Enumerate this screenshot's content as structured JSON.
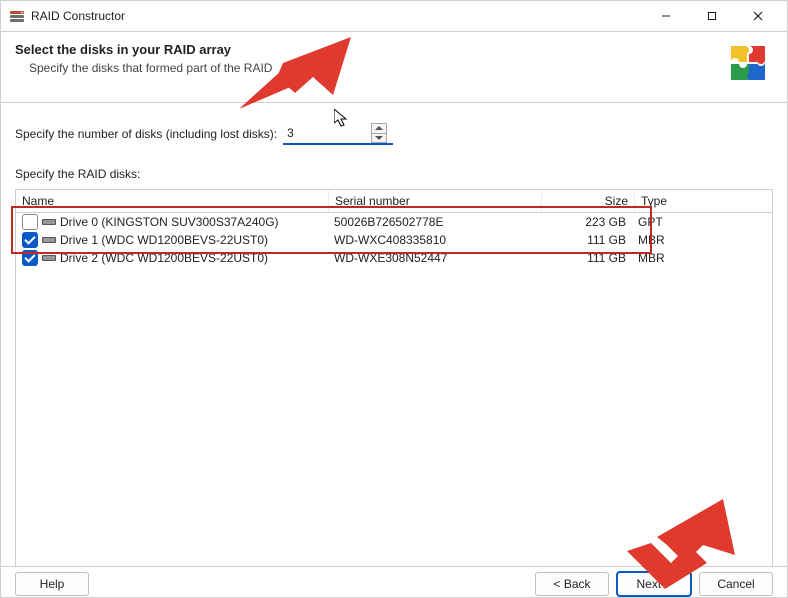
{
  "window": {
    "title": "RAID Constructor"
  },
  "banner": {
    "title": "Select the disks in your RAID array",
    "subtitle": "Specify the disks that formed part of the RAID"
  },
  "numdisks": {
    "label": "Specify the number of disks (including lost disks):",
    "value": "3"
  },
  "raiddisks": {
    "label": "Specify the RAID disks:",
    "columns": {
      "name": "Name",
      "serial": "Serial number",
      "size": "Size",
      "type": "Type"
    },
    "rows": [
      {
        "checked": false,
        "name": "Drive 0 (KINGSTON SUV300S37A240G)",
        "serial": "50026B726502778E",
        "size": "223 GB",
        "type": "GPT"
      },
      {
        "checked": true,
        "name": "Drive 1 (WDC WD1200BEVS-22UST0)",
        "serial": "WD-WXC408335810",
        "size": "111 GB",
        "type": "MBR"
      },
      {
        "checked": true,
        "name": "Drive 2 (WDC WD1200BEVS-22UST0)",
        "serial": "WD-WXE308N52447",
        "size": "111 GB",
        "type": "MBR"
      }
    ]
  },
  "buttons": {
    "help": "Help",
    "back": "< Back",
    "next": "Next >",
    "cancel": "Cancel"
  }
}
